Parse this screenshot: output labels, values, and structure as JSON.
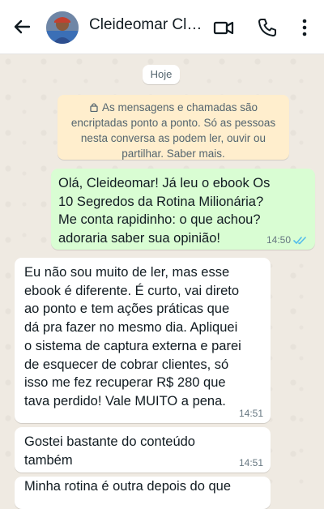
{
  "header": {
    "contact_name": "Cleideomar Clientes",
    "icons": [
      "back-arrow-icon",
      "video-call-icon",
      "voice-call-icon",
      "more-options-icon"
    ]
  },
  "chat": {
    "date_label": "Hoje",
    "encryption_notice": "As mensagens e chamadas são encriptadas ponto a ponto. Só as pessoas nesta conversa as podem ler, ouvir ou partilhar. Saber mais.",
    "messages": [
      {
        "direction": "outgoing",
        "text": "Olá, Cleideomar! Já leu o ebook Os\n10 Segredos da Rotina Milionária?\nMe conta rapidinho: o que achou?\nadoraria saber sua opinião!",
        "time": "14:50",
        "status": "read"
      },
      {
        "direction": "incoming",
        "text": "Eu não sou muito de ler, mas esse\nebook é diferente. É curto, vai direto\nao ponto e tem ações práticas que\ndá pra fazer no mesmo dia. Apliquei\no sistema de captura externa e parei\nde esquecer de cobrar clientes, só\nisso me fez recuperar R$ 280 que\ntava perdido! Vale MUITO a pena.",
        "time": "14:51"
      },
      {
        "direction": "incoming",
        "text": "Gostei bastante do conteúdo\ntambém",
        "time": "14:51"
      },
      {
        "direction": "incoming",
        "text": "Minha rotina é outra depois do que",
        "time": ""
      }
    ]
  },
  "colors": {
    "outgoing_bubble": "#d9fdd3",
    "incoming_bubble": "#ffffff",
    "notice_bubble": "#ffeecd",
    "read_ticks": "#53bdeb",
    "wallpaper": "#efeae2"
  }
}
